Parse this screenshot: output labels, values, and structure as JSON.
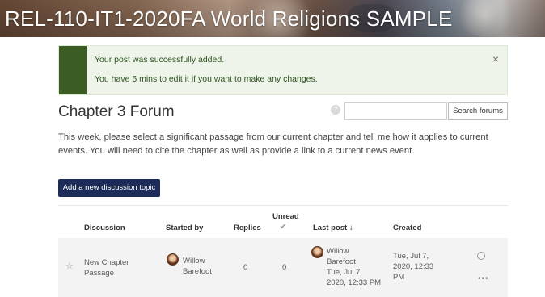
{
  "course": {
    "title": "REL-110-IT1-2020FA World Religions SAMPLE"
  },
  "alert": {
    "message": "Your post was successfully added.",
    "edit_note": "You have 5 mins to edit it if you want to make any changes.",
    "close": "×"
  },
  "forum": {
    "title": "Chapter 3 Forum",
    "search_placeholder": "",
    "search_button": "Search forums",
    "intro": "This week, please select a significant passage from our current chapter and tell me how it applies to current events. You will need to cite the chapter as well as provide a link to a current news event.",
    "add_topic": "Add a new discussion topic"
  },
  "table": {
    "headers": {
      "discussion": "Discussion",
      "started_by": "Started by",
      "replies": "Replies",
      "unread": "Unread",
      "last_post": "Last post ↓",
      "created": "Created"
    },
    "rows": [
      {
        "subject": "New Chapter Passage",
        "starter": "Willow Barefoot",
        "replies": "0",
        "unread": "0",
        "last_post_by": "Willow Barefoot",
        "last_post_date": "Tue, Jul 7, 2020, 12:33 PM",
        "created": "Tue, Jul 7, 2020, 12:33 PM"
      }
    ]
  },
  "icons": {
    "help": "question-circle-icon",
    "star": "star-icon",
    "avatar": "user-avatar",
    "subscribe": "subscribe-icon",
    "more": "more-icon",
    "check": "check-icon"
  },
  "colors": {
    "accent": "#1c2b57",
    "success_bar": "#3b5d23",
    "success_bg": "#eef4ea"
  }
}
